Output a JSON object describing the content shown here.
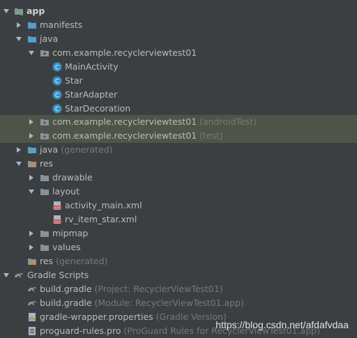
{
  "tree": {
    "app": "app",
    "manifests": "manifests",
    "java": "java",
    "package_main": "com.example.recyclerviewtest01",
    "classes": [
      "MainActivity",
      "Star",
      "StarAdapter",
      "StarDecoration"
    ],
    "package_android_test": "com.example.recyclerviewtest01",
    "package_android_test_suffix": "(androidTest)",
    "package_test": "com.example.recyclerviewtest01",
    "package_test_suffix": "(test)",
    "java_generated": "java",
    "java_generated_suffix": "(generated)",
    "res": "res",
    "drawable": "drawable",
    "layout": "layout",
    "layout_files": [
      "activity_main.xml",
      "rv_item_star.xml"
    ],
    "mipmap": "mipmap",
    "values": "values",
    "res_generated": "res",
    "res_generated_suffix": "(generated)",
    "gradle_scripts": "Gradle Scripts",
    "build_gradle_project": "build.gradle",
    "build_gradle_project_suffix": "(Project: RecyclerViewTest01)",
    "build_gradle_module": "build.gradle",
    "build_gradle_module_suffix": "(Module: RecyclerViewTest01.app)",
    "gradle_wrapper": "gradle-wrapper.properties",
    "gradle_wrapper_suffix": "(Gradle Version)",
    "proguard": "proguard-rules.pro",
    "proguard_suffix": "(ProGuard Rules for RecyclerViewTest01.app)"
  },
  "watermark": "https://blog.csdn.net/afdafvdaa",
  "colors": {
    "background": "#3c3f41",
    "highlight": "#4e5548",
    "folder_blue": "#4f9fcf",
    "class_icon": "#3592c4"
  }
}
